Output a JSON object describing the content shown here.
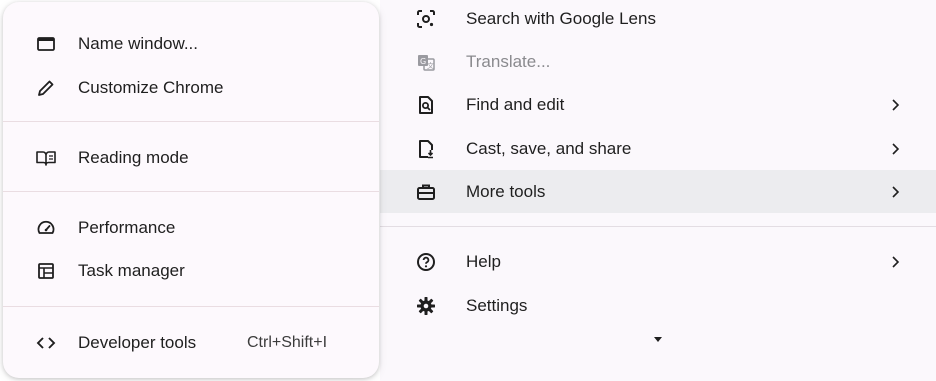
{
  "main_menu": {
    "items": [
      {
        "label": "Search with Google Lens",
        "icon": "google-lens-icon",
        "has_submenu": false,
        "disabled": false
      },
      {
        "label": "Translate...",
        "icon": "translate-icon",
        "has_submenu": false,
        "disabled": true
      },
      {
        "label": "Find and edit",
        "icon": "find-page-icon",
        "has_submenu": true,
        "disabled": false
      },
      {
        "label": "Cast, save, and share",
        "icon": "cast-save-share-icon",
        "has_submenu": true,
        "disabled": false
      },
      {
        "label": "More tools",
        "icon": "toolbox-icon",
        "has_submenu": true,
        "disabled": false,
        "highlighted": true
      },
      {
        "label": "Help",
        "icon": "help-icon",
        "has_submenu": true,
        "disabled": false
      },
      {
        "label": "Settings",
        "icon": "gear-icon",
        "has_submenu": false,
        "disabled": false
      }
    ],
    "scroll_indicator": "caret-down-icon"
  },
  "submenu": {
    "items": [
      {
        "label": "Name window...",
        "icon": "window-icon"
      },
      {
        "label": "Customize Chrome",
        "icon": "pencil-icon"
      },
      {
        "label": "Reading mode",
        "icon": "book-icon"
      },
      {
        "label": "Performance",
        "icon": "speedometer-icon"
      },
      {
        "label": "Task manager",
        "icon": "task-manager-icon"
      },
      {
        "label": "Developer tools",
        "icon": "code-icon",
        "shortcut": "Ctrl+Shift+I"
      }
    ]
  },
  "colors": {
    "menu_bg": "#fbf8fc",
    "hover_bg": "#ececef",
    "text": "#1f1f1f",
    "disabled_text": "#8a8a8e"
  }
}
